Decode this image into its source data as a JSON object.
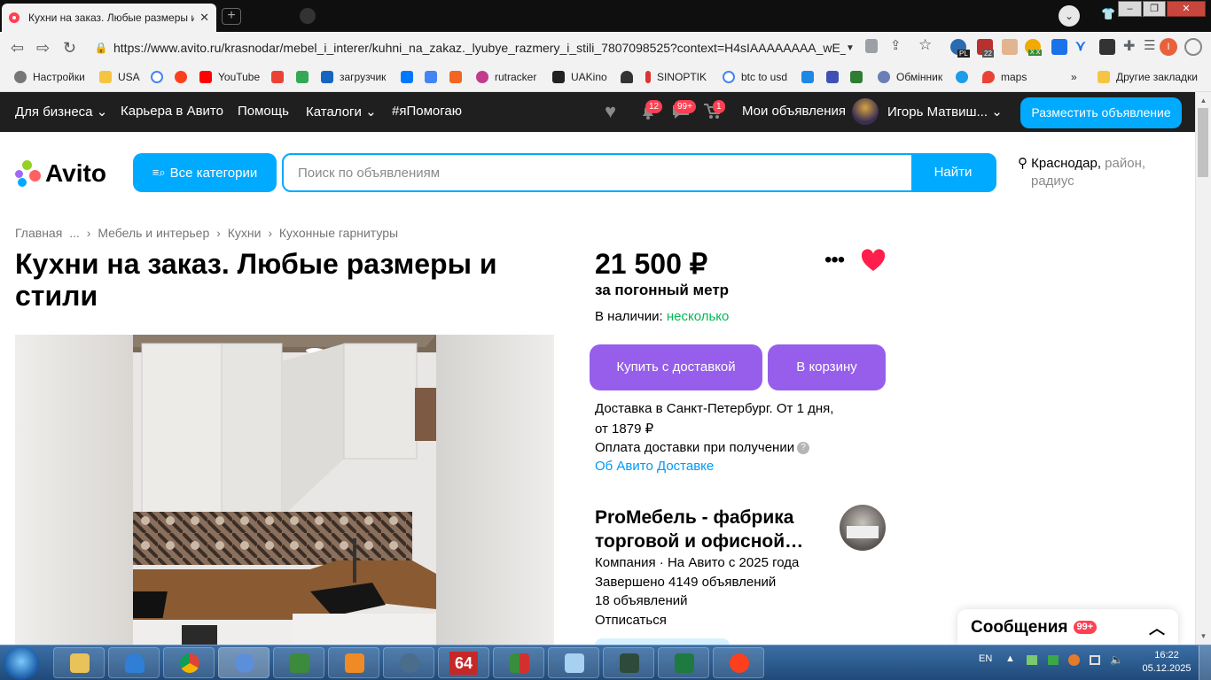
{
  "browser": {
    "tab_title": "Кухни на заказ. Любые размеры и стили",
    "tab_close": "✕",
    "url": "https://www.avito.ru/krasnodar/mebel_i_interer/kuhni_na_zakaz._lyubye_razmery_i_stili_7807098525?context=H4sIAAAAAAAA_wE_...",
    "bookmarks": [
      "Настройки",
      "USA",
      "YouTube",
      "загрузчик",
      "rutracker",
      "UAKino",
      "SINOPTIK",
      "btc to usd",
      "Обмінник",
      "maps"
    ],
    "other_bookmarks": "Другие закладки",
    "more_bookmarks": "»",
    "ext_badge_pl": "PL",
    "ext_badge_22": "22",
    "ext_badge_xx": "X X",
    "profile_initial": "I"
  },
  "topnav": {
    "business": "Для бизнеса",
    "career": "Карьера в Авито",
    "help": "Помощь",
    "catalogs": "Каталоги",
    "help_tag": "#яПомогаю",
    "bell_count": "12",
    "chat_count": "99+",
    "cart_count": "1",
    "my_ads": "Мои объявления",
    "user_name": "Игорь Матвиш...",
    "post_ad": "Разместить объявление"
  },
  "header": {
    "logo_text": "Avito",
    "all_categories": "Все категории",
    "search_placeholder": "Поиск по объявлениям",
    "search_button": "Найти",
    "location_city": "Краснодар,",
    "location_rest1": "район,",
    "location_rest2": "радиус"
  },
  "breadcrumbs": [
    "Главная",
    "...",
    "Мебель и интерьер",
    "Кухни",
    "Кухонные гарнитуры"
  ],
  "listing": {
    "title": "Кухни на заказ. Любые размеры и стили",
    "price": "21 500 ₽",
    "price_unit": "за погонный метр",
    "stock_label": "В наличии:",
    "stock_value": "несколько",
    "buy_delivery": "Купить с доставкой",
    "to_cart": "В корзину",
    "delivery_line1": "Доставка в Санкт-Петербург. От 1 дня,",
    "delivery_line2": "от 1879 ₽",
    "payment_on_receipt": "Оплата доставки при получении",
    "about_delivery": "Об Авито Доставке"
  },
  "seller": {
    "name": "ProМебель - фабрика торговой и офисной…",
    "meta": "Компания · На Авито с 2025 года",
    "completed": "Завершено 4149 объявлений",
    "active": "18 объявлений",
    "unsubscribe": "Отписаться"
  },
  "messages": {
    "label": "Сообщения",
    "count": "99+"
  },
  "taskbar": {
    "lang": "EN",
    "time": "16:22",
    "date": "05.12.2025",
    "app_64": "64"
  },
  "colors": {
    "avito_blue": "#00aaff",
    "purple": "#965eeb",
    "green": "#02b856",
    "red": "#ff4053",
    "link": "#0099f7"
  }
}
